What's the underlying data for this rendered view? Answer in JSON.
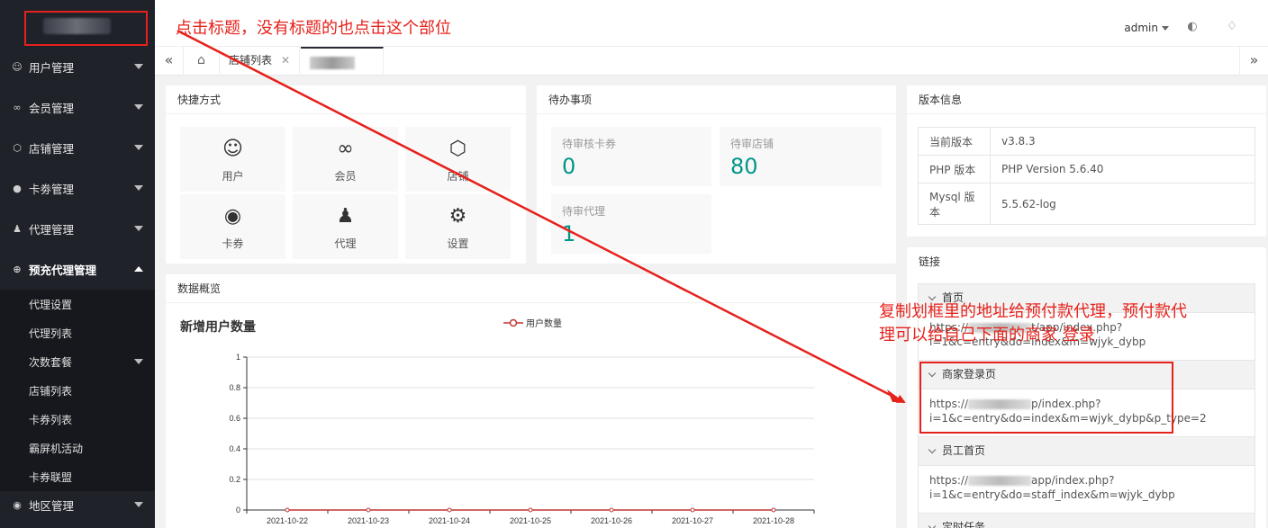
{
  "header": {
    "admin_label": "admin"
  },
  "sidebar": {
    "items": [
      {
        "label": "用户管理",
        "icon": "user-icon"
      },
      {
        "label": "会员管理",
        "icon": "infinity-icon"
      },
      {
        "label": "店铺管理",
        "icon": "cube-icon"
      },
      {
        "label": "卡劵管理",
        "icon": "circle-icon"
      },
      {
        "label": "代理管理",
        "icon": "person-icon"
      },
      {
        "label": "预充代理管理",
        "icon": "plus-circle-icon"
      }
    ],
    "submenu": [
      "代理设置",
      "代理列表",
      "次数套餐",
      "店铺列表",
      "卡券列表",
      "霸屏机活动",
      "卡券联盟"
    ],
    "last_item": "地区管理"
  },
  "tabs": {
    "store_list": "店铺列表"
  },
  "shortcuts": {
    "title": "快捷方式",
    "items": [
      {
        "label": "用户",
        "icon": "user-outline-icon"
      },
      {
        "label": "会员",
        "icon": "infinity-icon"
      },
      {
        "label": "店铺",
        "icon": "cube-icon"
      },
      {
        "label": "卡券",
        "icon": "record-icon"
      },
      {
        "label": "代理",
        "icon": "person-icon"
      },
      {
        "label": "设置",
        "icon": "gear-icon"
      }
    ]
  },
  "todo": {
    "title": "待办事项",
    "items": [
      {
        "label": "待审核卡券",
        "value": "0"
      },
      {
        "label": "待审店铺",
        "value": "80"
      },
      {
        "label": "待审代理",
        "value": "1"
      }
    ]
  },
  "version": {
    "title": "版本信息",
    "rows": [
      {
        "key": "当前版本",
        "value": "v3.8.3"
      },
      {
        "key": "PHP 版本",
        "value": "PHP Version 5.6.40"
      },
      {
        "key": "Mysql 版本",
        "value": "5.5.62-log"
      }
    ]
  },
  "links": {
    "title": "链接",
    "sections": [
      {
        "title": "首页",
        "url_a": "https://",
        "url_b": "t/app/index.php?",
        "url_c": "i=1&c=entry&do=index&m=wjyk_dybp"
      },
      {
        "title": "商家登录页",
        "url_a": "https://",
        "url_b": "p/index.php?",
        "url_c": "i=1&c=entry&do=index&m=wjyk_dybp&p_type=2"
      },
      {
        "title": "员工首页",
        "url_a": "https://",
        "url_b": "app/index.php?",
        "url_c": "i=1&c=entry&do=staff_index&m=wjyk_dybp"
      },
      {
        "title": "定时任务"
      }
    ]
  },
  "overview": {
    "title": "数据概览"
  },
  "chart_data": {
    "type": "line",
    "title": "新增用户数量",
    "x": [
      "2021-10-22",
      "2021-10-23",
      "2021-10-24",
      "2021-10-25",
      "2021-10-26",
      "2021-10-27",
      "2021-10-28"
    ],
    "series": [
      {
        "name": "用户数量",
        "values": [
          0,
          0,
          0,
          0,
          0,
          0,
          0
        ]
      }
    ],
    "y_ticks": [
      "0",
      "0.2",
      "0.4",
      "0.6",
      "0.8",
      "1"
    ],
    "ylim": [
      0,
      1
    ],
    "grid": true,
    "legend": "top-center",
    "color": "#c23531"
  },
  "annotations": {
    "top": "点击标题，没有标题的也点击这个部位",
    "right_line1": "复制划框里的地址给预付款代理，预付款代",
    "right_line2": "理可以给自己下面的商家    登录",
    "color": "#e6211b"
  }
}
